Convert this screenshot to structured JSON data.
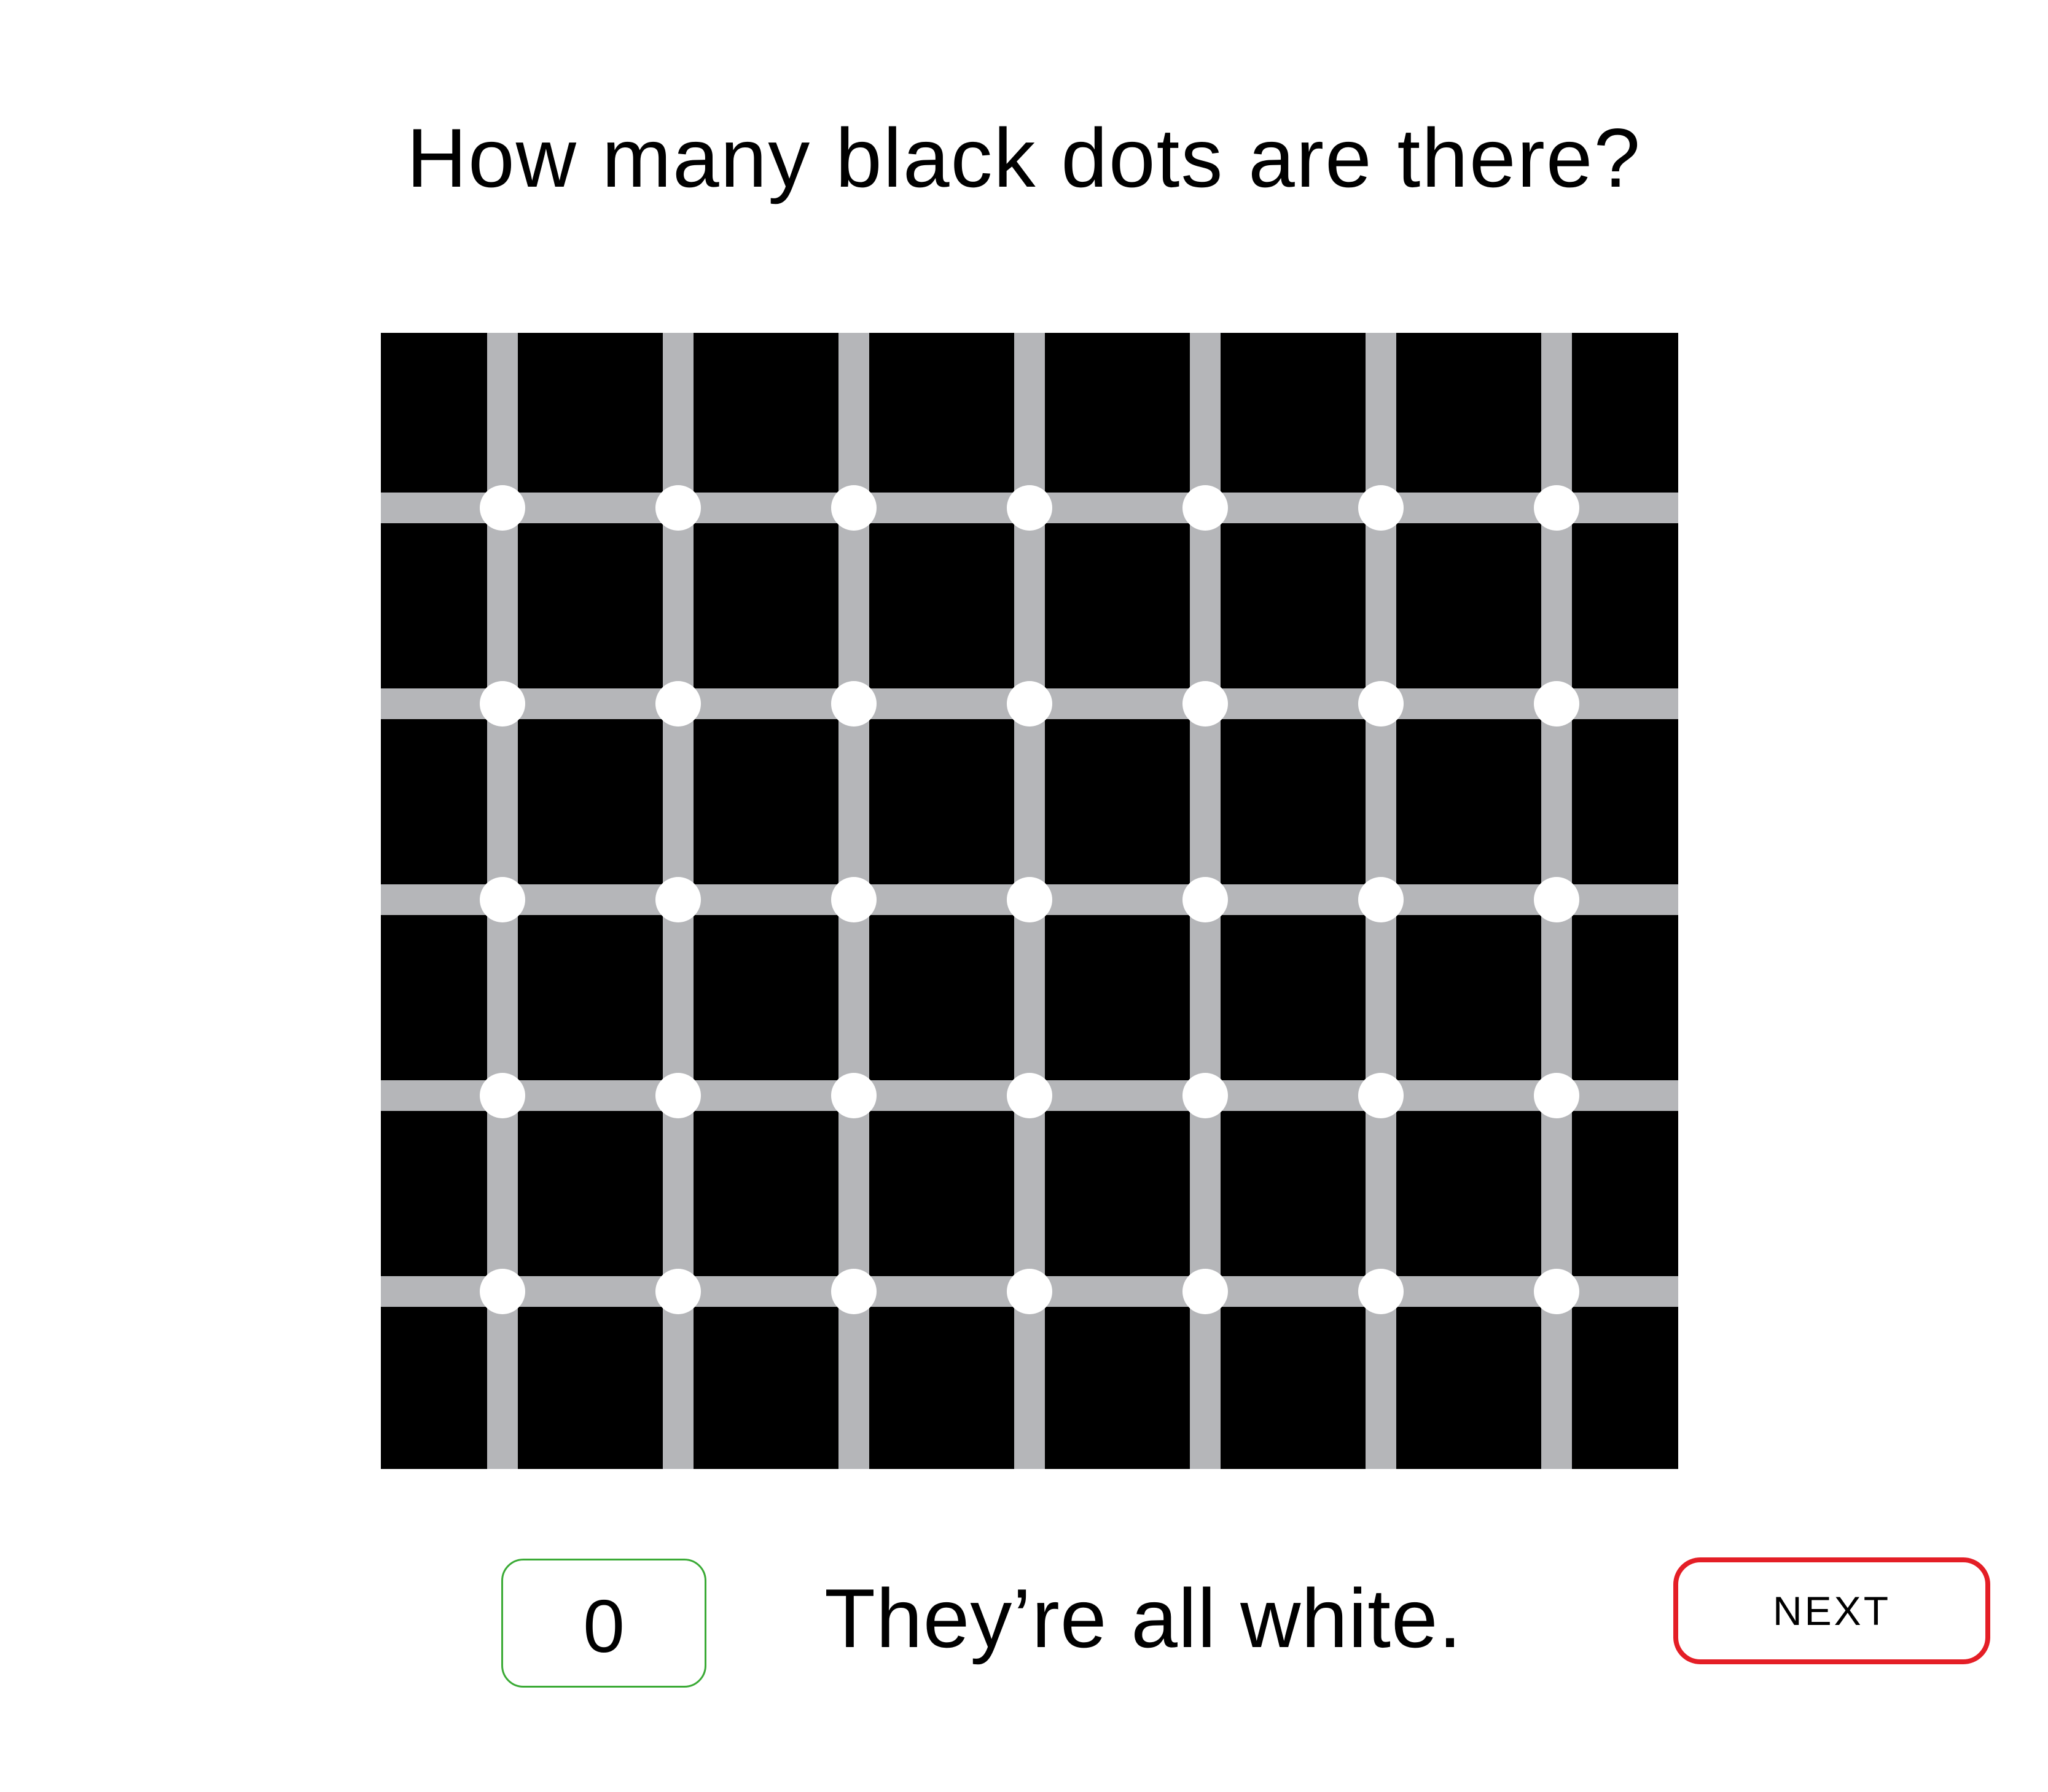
{
  "question": "How many black dots are there?",
  "illusion": {
    "name": "scintillating-grid",
    "columns": 7,
    "rows": 5,
    "background_color": "#000000",
    "line_color": "#b5b6b9",
    "dot_color": "#ffffff"
  },
  "answer": {
    "value": "0",
    "text": "They’re all white.",
    "box_color": "#3aaa35"
  },
  "next_button": {
    "label": "NEXT",
    "border_color": "#e41e26"
  }
}
